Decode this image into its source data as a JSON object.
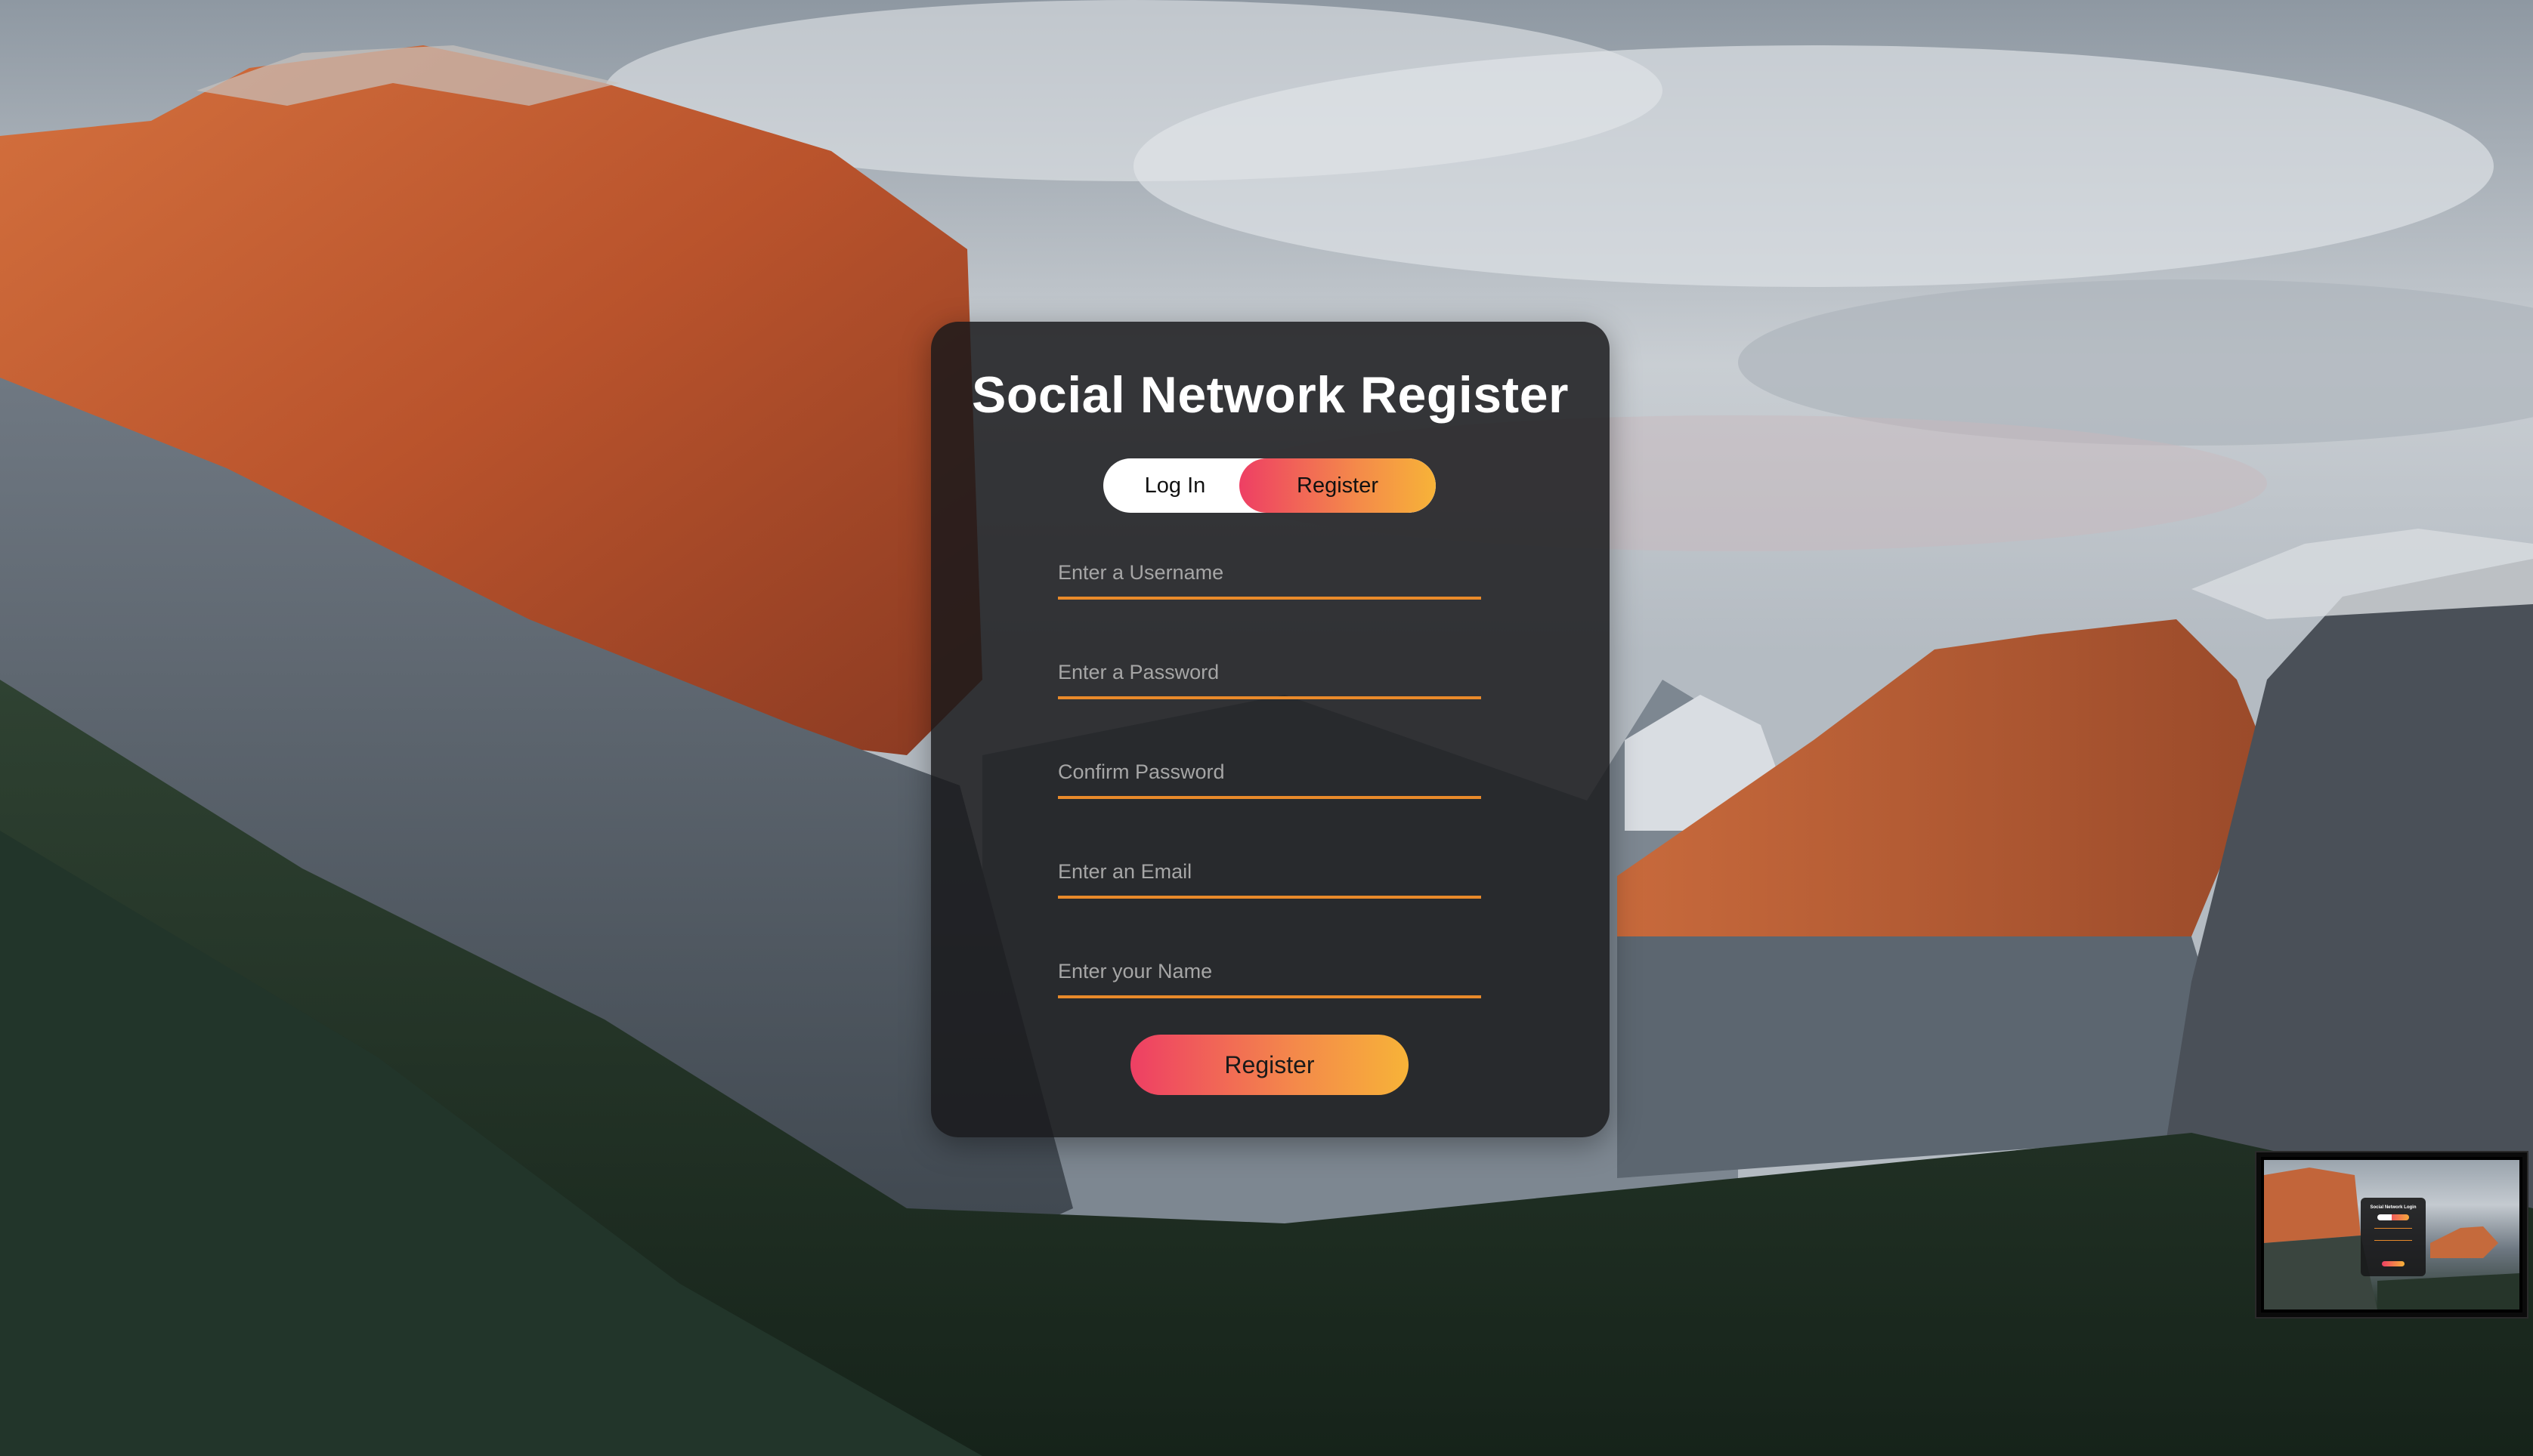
{
  "page": {
    "title": "Social Network Register"
  },
  "tabs": {
    "login_label": "Log In",
    "register_label": "Register",
    "active": "Register"
  },
  "form": {
    "username_placeholder": "Enter a Username",
    "password_placeholder": "Enter a Password",
    "confirm_placeholder": "Confirm Password",
    "email_placeholder": "Enter an Email",
    "name_placeholder": "Enter your Name",
    "submit_label": "Register"
  },
  "thumbnail": {
    "title": "Social Network Login"
  },
  "colors": {
    "accent_start": "#ee3f64",
    "accent_end": "#f7b338",
    "field_underline": "#e98a2a",
    "card_background": "rgba(24,24,26,0.84)"
  }
}
